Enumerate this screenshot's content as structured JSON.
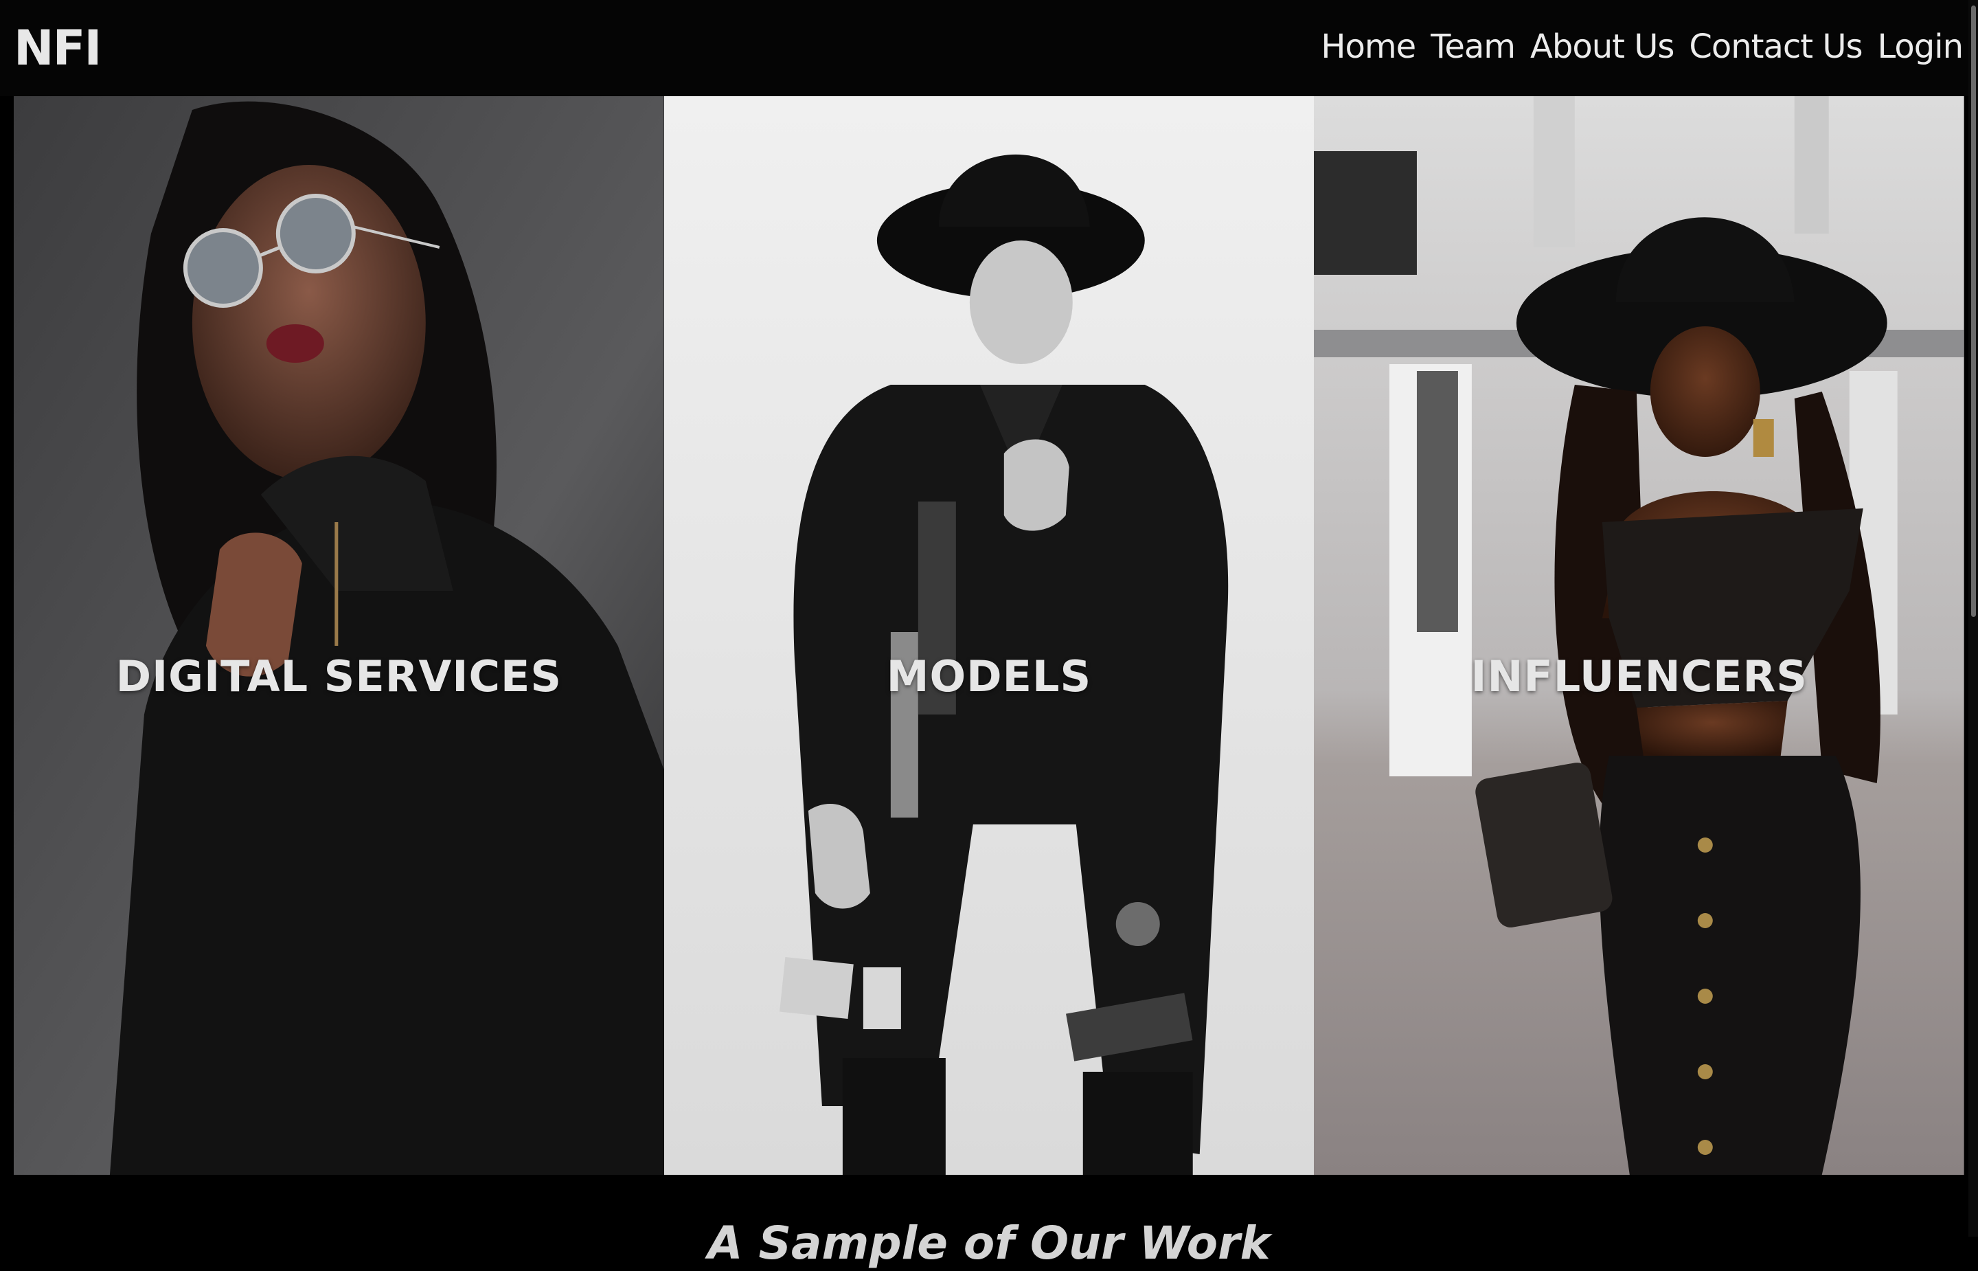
{
  "brand": {
    "logo": "NFI"
  },
  "nav": {
    "items": [
      "Home",
      "Team",
      "About Us",
      "Contact Us",
      "Login"
    ]
  },
  "panels": [
    {
      "label": "DIGITAL SERVICES"
    },
    {
      "label": "MODELS"
    },
    {
      "label": "INFLUENCERS"
    }
  ],
  "section": {
    "heading": "A Sample of Our Work"
  },
  "colors": {
    "background": "#000000",
    "nav_text": "#ececec",
    "panel_label": "#e6e6e6"
  }
}
